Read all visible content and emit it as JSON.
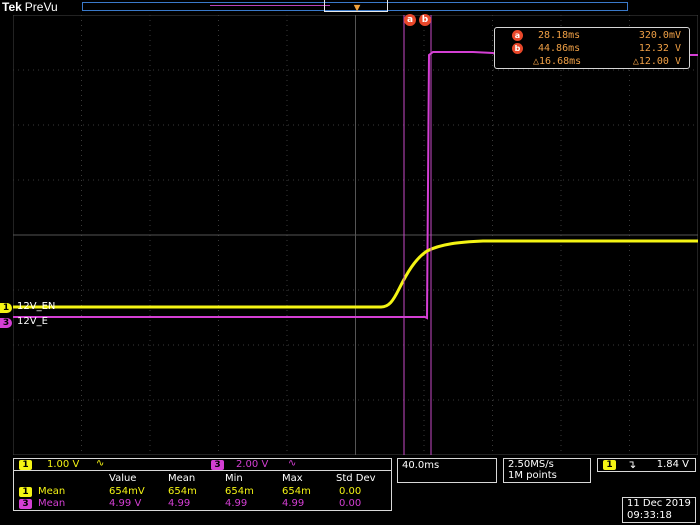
{
  "brand": {
    "name": "Tek",
    "mode": "PreVu"
  },
  "cursors": {
    "a_label": "a",
    "b_label": "b"
  },
  "readout": {
    "a": {
      "label": "a",
      "time": "28.18ms",
      "value": "320.0mV"
    },
    "b": {
      "label": "b",
      "time": "44.86ms",
      "value": "12.32 V"
    },
    "delta": {
      "time": "△16.68ms",
      "value": "△12.00 V"
    }
  },
  "channels": {
    "ch1": {
      "num": "1",
      "name": "12V_EN",
      "scale": "1.00 V",
      "color": "#f4f414"
    },
    "ch3": {
      "num": "3",
      "name": "12V_E",
      "scale": "2.00 V",
      "color": "#d43fd4"
    }
  },
  "timebase": {
    "scale": "40.0ms",
    "rate": "2.50MS/s",
    "points": "1M points"
  },
  "trigger": {
    "channel": "1",
    "level": "1.84 V",
    "slope_icon": "falling-edge-icon"
  },
  "measurements": {
    "headers": [
      "Value",
      "Mean",
      "Min",
      "Max",
      "Std Dev"
    ],
    "rows": [
      {
        "ch": "1",
        "name": "Mean",
        "values": [
          "654mV",
          "654m",
          "654m",
          "654m",
          "0.00"
        ]
      },
      {
        "ch": "3",
        "name": "Mean",
        "values": [
          "4.99 V",
          "4.99",
          "4.99",
          "4.99",
          "0.00"
        ]
      }
    ]
  },
  "datetime": {
    "date": "11 Dec 2019",
    "time": "09:33:18"
  }
}
